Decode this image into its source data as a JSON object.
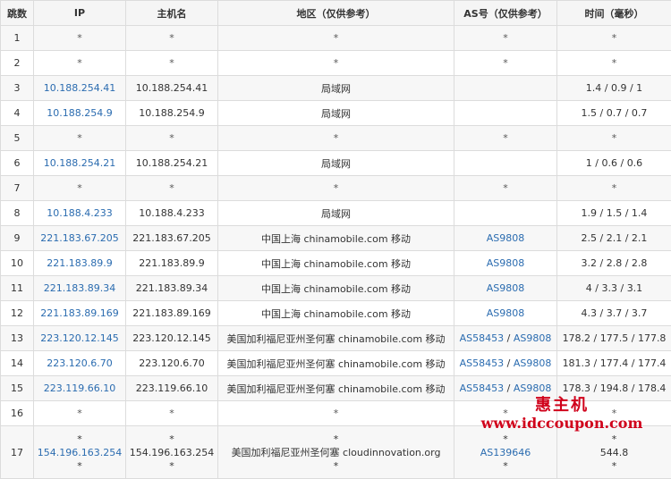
{
  "headers": {
    "hop": "跳数",
    "ip": "IP",
    "host": "主机名",
    "region": "地区（仅供参考）",
    "as": "AS号（仅供参考）",
    "time": "时间（毫秒）"
  },
  "rows": [
    {
      "hop": "1",
      "ip": "*",
      "host": "*",
      "region": "*",
      "as": [
        "*"
      ],
      "time": "*"
    },
    {
      "hop": "2",
      "ip": "*",
      "host": "*",
      "region": "*",
      "as": [
        "*"
      ],
      "time": "*"
    },
    {
      "hop": "3",
      "ip": "10.188.254.41",
      "host": "10.188.254.41",
      "region": "局域网",
      "as": [],
      "time": "1.4 / 0.9 / 1"
    },
    {
      "hop": "4",
      "ip": "10.188.254.9",
      "host": "10.188.254.9",
      "region": "局域网",
      "as": [],
      "time": "1.5 / 0.7 / 0.7"
    },
    {
      "hop": "5",
      "ip": "*",
      "host": "*",
      "region": "*",
      "as": [
        "*"
      ],
      "time": "*"
    },
    {
      "hop": "6",
      "ip": "10.188.254.21",
      "host": "10.188.254.21",
      "region": "局域网",
      "as": [],
      "time": "1 / 0.6 / 0.6"
    },
    {
      "hop": "7",
      "ip": "*",
      "host": "*",
      "region": "*",
      "as": [
        "*"
      ],
      "time": "*"
    },
    {
      "hop": "8",
      "ip": "10.188.4.233",
      "host": "10.188.4.233",
      "region": "局域网",
      "as": [],
      "time": "1.9 / 1.5 / 1.4"
    },
    {
      "hop": "9",
      "ip": "221.183.67.205",
      "host": "221.183.67.205",
      "region": "中国上海 chinamobile.com 移动",
      "as": [
        "AS9808"
      ],
      "time": "2.5 / 2.1 / 2.1"
    },
    {
      "hop": "10",
      "ip": "221.183.89.9",
      "host": "221.183.89.9",
      "region": "中国上海 chinamobile.com 移动",
      "as": [
        "AS9808"
      ],
      "time": "3.2 / 2.8 / 2.8"
    },
    {
      "hop": "11",
      "ip": "221.183.89.34",
      "host": "221.183.89.34",
      "region": "中国上海 chinamobile.com 移动",
      "as": [
        "AS9808"
      ],
      "time": "4 / 3.3 / 3.1"
    },
    {
      "hop": "12",
      "ip": "221.183.89.169",
      "host": "221.183.89.169",
      "region": "中国上海 chinamobile.com 移动",
      "as": [
        "AS9808"
      ],
      "time": "4.3 / 3.7 / 3.7"
    },
    {
      "hop": "13",
      "ip": "223.120.12.145",
      "host": "223.120.12.145",
      "region": "美国加利福尼亚州圣何塞 chinamobile.com 移动",
      "as": [
        "AS58453",
        "AS9808"
      ],
      "time": "178.2 / 177.5 / 177.8"
    },
    {
      "hop": "14",
      "ip": "223.120.6.70",
      "host": "223.120.6.70",
      "region": "美国加利福尼亚州圣何塞 chinamobile.com 移动",
      "as": [
        "AS58453",
        "AS9808"
      ],
      "time": "181.3 / 177.4 / 177.4"
    },
    {
      "hop": "15",
      "ip": "223.119.66.10",
      "host": "223.119.66.10",
      "region": "美国加利福尼亚州圣何塞 chinamobile.com 移动",
      "as": [
        "AS58453",
        "AS9808"
      ],
      "time": "178.3 / 194.8 / 178.4"
    },
    {
      "hop": "16",
      "ip": "*",
      "host": "*",
      "region": "*",
      "as": [
        "*"
      ],
      "time": "*"
    }
  ],
  "last_row": {
    "hop": "17",
    "ip": [
      "*",
      "154.196.163.254",
      "*"
    ],
    "host": [
      "*",
      "154.196.163.254",
      "*"
    ],
    "region": [
      "*",
      "美国加利福尼亚州圣何塞 cloudinnovation.org",
      "*"
    ],
    "as": [
      "*",
      "AS139646",
      "*"
    ],
    "time": [
      "*",
      "544.8",
      "*"
    ]
  },
  "watermark": {
    "line1": "惠主机",
    "line2": "www.idccoupon.com",
    "color": "#d0021b"
  },
  "colors": {
    "link": "#2b6cb0",
    "header_bg": "#f5f5f5",
    "odd_row_bg": "#f7f7f7",
    "border": "#dcdcdc"
  }
}
